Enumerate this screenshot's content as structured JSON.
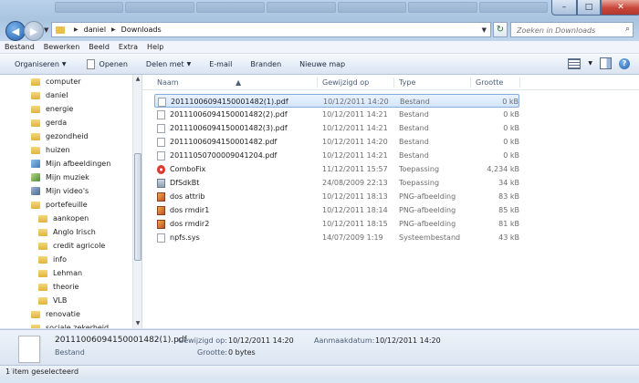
{
  "window": {
    "minimize": "–",
    "maximize": "□",
    "close": "✕"
  },
  "address": {
    "crumbs": [
      "daniel",
      "Downloads"
    ],
    "search_placeholder": "Zoeken in Downloads"
  },
  "menu": [
    "Bestand",
    "Bewerken",
    "Beeld",
    "Extra",
    "Help"
  ],
  "toolbar": {
    "organize": "Organiseren",
    "open": "Openen",
    "share": "Delen met",
    "email": "E-mail",
    "burn": "Branden",
    "new_map": "Nieuwe map"
  },
  "tree": [
    {
      "label": "computer",
      "kind": "folder"
    },
    {
      "label": "daniel",
      "kind": "folder"
    },
    {
      "label": "energie",
      "kind": "folder"
    },
    {
      "label": "gerda",
      "kind": "folder"
    },
    {
      "label": "gezondheid",
      "kind": "folder"
    },
    {
      "label": "huizen",
      "kind": "folder"
    },
    {
      "label": "Mijn afbeeldingen",
      "kind": "pictures"
    },
    {
      "label": "Mijn muziek",
      "kind": "music"
    },
    {
      "label": "Mijn video's",
      "kind": "video"
    },
    {
      "label": "portefeuille",
      "kind": "folder"
    },
    {
      "label": "aankopen",
      "kind": "folder"
    },
    {
      "label": "Anglo Irisch",
      "kind": "folder"
    },
    {
      "label": "credit agricole",
      "kind": "folder"
    },
    {
      "label": "info",
      "kind": "folder"
    },
    {
      "label": "Lehman",
      "kind": "folder"
    },
    {
      "label": "theorie",
      "kind": "folder"
    },
    {
      "label": "VLB",
      "kind": "folder"
    },
    {
      "label": "renovatie",
      "kind": "folder"
    },
    {
      "label": "sociale zekerheid",
      "kind": "folder"
    }
  ],
  "columns": [
    "Naam",
    "Gewijzigd op",
    "Type",
    "Grootte"
  ],
  "files": [
    {
      "name": "20111006094150001482(1).pdf",
      "modified": "10/12/2011 14:20",
      "type": "Bestand",
      "size": "0 kB",
      "icon": "pdf",
      "selected": true
    },
    {
      "name": "20111006094150001482(2).pdf",
      "modified": "10/12/2011 14:21",
      "type": "Bestand",
      "size": "0 kB",
      "icon": "pdf"
    },
    {
      "name": "20111006094150001482(3).pdf",
      "modified": "10/12/2011 14:21",
      "type": "Bestand",
      "size": "0 kB",
      "icon": "pdf"
    },
    {
      "name": "20111006094150001482.pdf",
      "modified": "10/12/2011 14:20",
      "type": "Bestand",
      "size": "0 kB",
      "icon": "pdf"
    },
    {
      "name": "20111050700009041204.pdf",
      "modified": "10/12/2011 14:21",
      "type": "Bestand",
      "size": "0 kB",
      "icon": "pdf"
    },
    {
      "name": "ComboFix",
      "modified": "11/12/2011 15:57",
      "type": "Toepassing",
      "size": "4,234 kB",
      "icon": "exe"
    },
    {
      "name": "DfSdkBt",
      "modified": "24/08/2009 22:13",
      "type": "Toepassing",
      "size": "34 kB",
      "icon": "exe2"
    },
    {
      "name": "dos attrib",
      "modified": "10/12/2011 18:13",
      "type": "PNG-afbeelding",
      "size": "83 kB",
      "icon": "png"
    },
    {
      "name": "dos rmdir1",
      "modified": "10/12/2011 18:14",
      "type": "PNG-afbeelding",
      "size": "85 kB",
      "icon": "png"
    },
    {
      "name": "dos rmdir2",
      "modified": "10/12/2011 18:15",
      "type": "PNG-afbeelding",
      "size": "81 kB",
      "icon": "png"
    },
    {
      "name": "npfs.sys",
      "modified": "14/07/2009 1:19",
      "type": "Systeembestand",
      "size": "43 kB",
      "icon": "sys"
    }
  ],
  "details": {
    "name": "20111006094150001482(1).pdf",
    "type": "Bestand",
    "modified_label": "Gewijzigd op:",
    "modified_value": "10/12/2011 14:20",
    "size_label": "Grootte:",
    "size_value": "0 bytes",
    "created_label": "Aanmaakdatum:",
    "created_value": "10/12/2011 14:20"
  },
  "status": "1 item geselecteerd",
  "colors": {
    "accent": "#1f5fa8",
    "folder": "#e8c14d",
    "selection": "#d3e6fb"
  }
}
